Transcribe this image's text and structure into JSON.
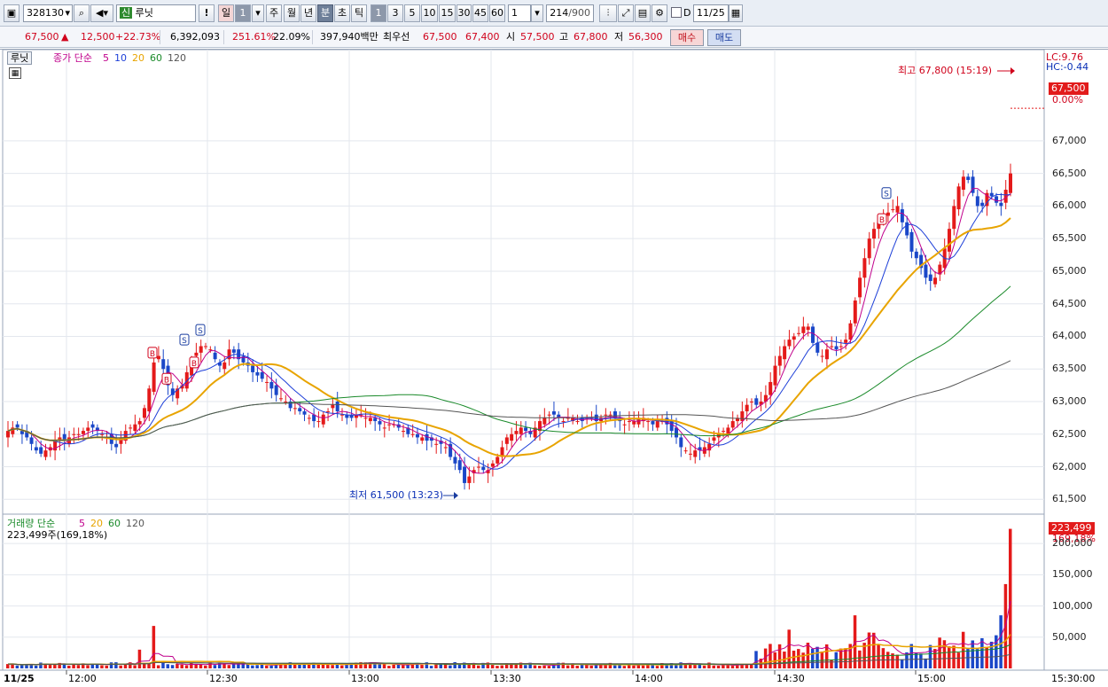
{
  "toolbar": {
    "code": "328130",
    "badge": "신",
    "name": "루닛",
    "alert": "!",
    "day_label": "일",
    "day_value": "1",
    "periods": [
      "주",
      "월",
      "년",
      "분",
      "초",
      "틱"
    ],
    "intervals": [
      "1",
      "3",
      "5",
      "10",
      "15",
      "30",
      "45",
      "60"
    ],
    "interval_value": "1",
    "count": "214",
    "count_total": "/900",
    "d_label": "D",
    "date": "11/25"
  },
  "info": {
    "price": "67,500",
    "arrow": "▲",
    "change": "12,500",
    "change_pct": "+22.73%",
    "volume": "6,392,093",
    "vol_ratio": "251.61%",
    "turnover": "22.09%",
    "amount": "397,940백만",
    "bid_label": "최우선",
    "bid1": "67,500",
    "bid2": "67,400",
    "open_label": "시",
    "open": "57,500",
    "high_label": "고",
    "high": "67,800",
    "low_label": "저",
    "low": "56,300",
    "buy": "매수",
    "sell": "매도"
  },
  "price_panel": {
    "name_tag": "루닛",
    "legend_prefix": "종가 단순",
    "ma_labels": [
      "5",
      "10",
      "20",
      "60",
      "120"
    ],
    "ma_colors": [
      "#c0008c",
      "#1d3fd8",
      "#e8a400",
      "#1a8a2a",
      "#555555"
    ],
    "lc": "LC:9.76",
    "hc": "HC:-0.44",
    "high_note": "최고 67,800 (15:19)",
    "low_note": "최저 61,500 (13:23)",
    "last_price": "67,500",
    "last_pct": "0.00%",
    "y_ticks": [
      "67,000",
      "66,500",
      "66,000",
      "65,500",
      "65,000",
      "64,500",
      "64,000",
      "63,500",
      "63,000",
      "62,500",
      "62,000",
      "61,500"
    ]
  },
  "volume_panel": {
    "legend_prefix": "거래량 단순",
    "ma_labels": [
      "5",
      "20",
      "60",
      "120"
    ],
    "ma_colors": [
      "#c0008c",
      "#e8a400",
      "#1a8a2a",
      "#555555"
    ],
    "last_value": "223,499주(169,18%)",
    "last_badge": "223,499",
    "last_pct": "169,18%",
    "y_ticks": [
      "200,000",
      "150,000",
      "100,000",
      "50,000"
    ]
  },
  "x_axis": {
    "date": "11/25",
    "ticks": [
      "12:00",
      "12:30",
      "13:00",
      "13:30",
      "14:00",
      "14:30",
      "15:00"
    ],
    "end": "15:30:00"
  },
  "chart_data": {
    "type": "candlestick",
    "y_range": [
      61300,
      68100
    ],
    "volume_range": [
      0,
      230000
    ],
    "high": 67800,
    "low": 61500,
    "close": 67500
  }
}
